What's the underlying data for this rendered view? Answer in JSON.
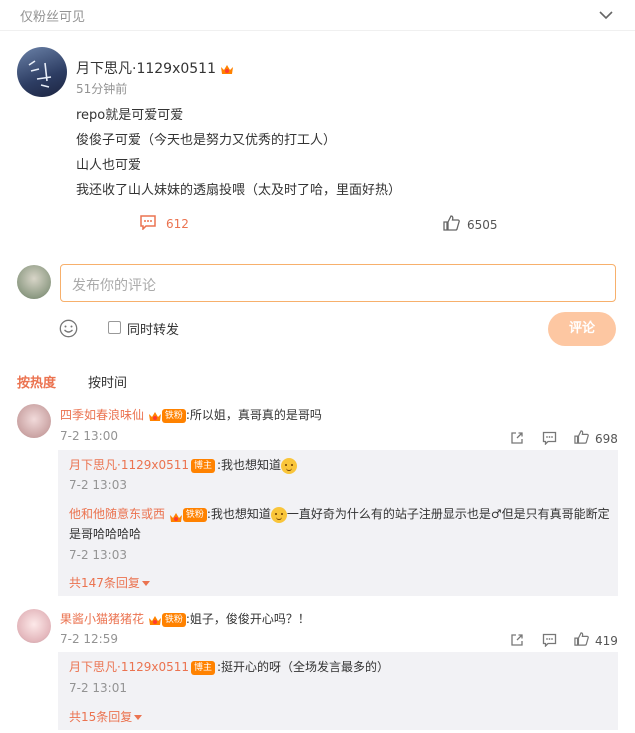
{
  "visibility": {
    "label": "仅粉丝可见"
  },
  "post": {
    "author": "月下思凡·1129x0511",
    "time": "51分钟前",
    "lines": [
      "repo就是可爱可爱",
      "俊俊子可爱（今天也是努力又优秀的打工人）",
      "山人也可爱",
      "我还收了山人妹妹的透扇投喂（太及时了哈，里面好热）"
    ],
    "comment_count": "612",
    "like_count": "6505"
  },
  "composer": {
    "placeholder": "发布你的评论",
    "repost_label": "同时转发",
    "submit_label": "评论"
  },
  "sort": {
    "hot": "按热度",
    "time": "按时间"
  },
  "comments": [
    {
      "user": "四季如春浪味仙",
      "fan_badge": "铁粉",
      "text": ":所以姐，真哥真的是哥吗",
      "time": "7-2 13:00",
      "likes": "698",
      "replies": [
        {
          "user": "月下思凡·1129x0511",
          "badge": "博主",
          "text": ":我也想知道",
          "time": "7-2 13:03"
        },
        {
          "user": "他和他随意东或西",
          "badge": "铁粉",
          "text_before": ":我也想知道",
          "text_after": "一直好奇为什么有的站子注册显示也是♂但是只有真哥能断定是哥哈哈哈哈",
          "time": "7-2 13:03"
        }
      ],
      "more_replies": "共147条回复"
    },
    {
      "user": "果酱小猫猪猪花",
      "fan_badge": "铁粉",
      "text": ":姐子，俊俊开心吗？！",
      "time": "7-2 12:59",
      "likes": "419",
      "replies": [
        {
          "user": "月下思凡·1129x0511",
          "badge": "博主",
          "text": ":挺开心的呀（全场发言最多的）",
          "time": "7-2 13:01"
        }
      ],
      "more_replies": "共15条回复"
    }
  ],
  "colors": {
    "accent": "#eb7350",
    "muted": "#939393",
    "reply_bg": "#f2f2f5",
    "submit_bg": "#fdc7a2"
  },
  "icons": [
    "chevron-down-icon",
    "comment-icon",
    "like-icon",
    "emoji-icon",
    "checkbox-icon",
    "share-icon",
    "crown-icon"
  ]
}
